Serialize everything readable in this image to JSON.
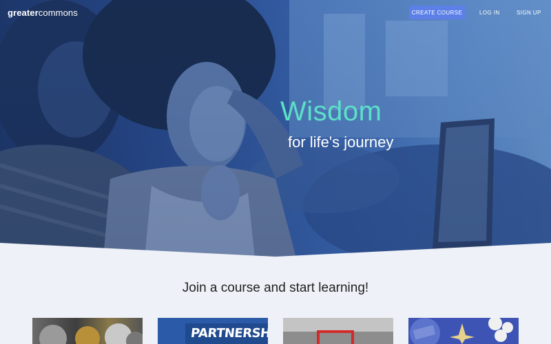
{
  "header": {
    "logo_bold": "greater",
    "logo_regular": "commons",
    "create_course_label": "CREATE COURSE",
    "login_label": "LOG IN",
    "signup_label": "SIGN UP"
  },
  "hero": {
    "title": "Wisdom",
    "subtitle": "for life's journey"
  },
  "courses": {
    "heading": "Join a course and start learning!",
    "cards": [
      {
        "thumbnail": "coins-thumbnail"
      },
      {
        "thumbnail": "partnership-thumbnail",
        "text": "PARTNERSHIP"
      },
      {
        "thumbnail": "frame-thumbnail"
      },
      {
        "thumbnail": "compass-money-thumbnail"
      }
    ]
  },
  "colors": {
    "accent_button": "#5c80e8",
    "hero_title": "#5ce0c8",
    "page_background": "#eef1f7"
  }
}
